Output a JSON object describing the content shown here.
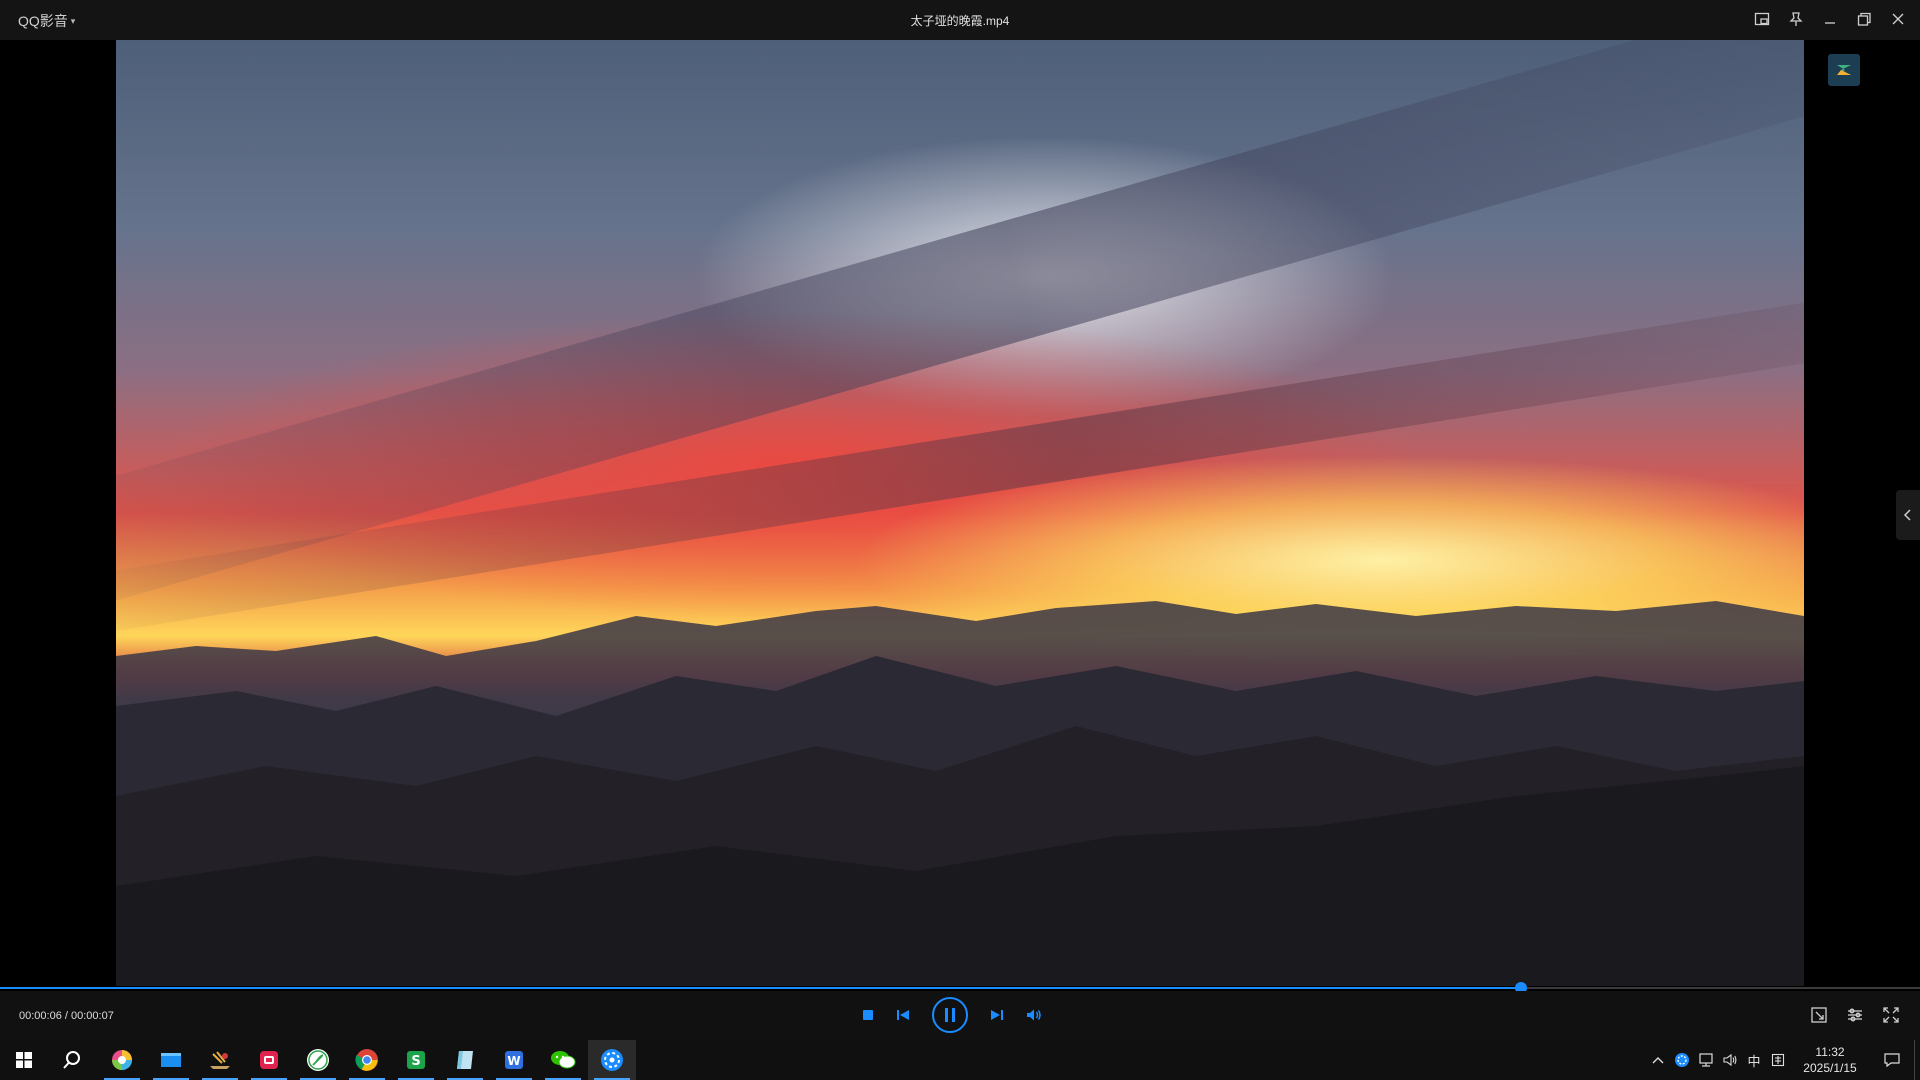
{
  "app": {
    "brand": "QQ影音",
    "title": "太子垭的晚霞.mp4"
  },
  "window_controls": [
    "miniplayer-icon",
    "pin-icon",
    "minimize-icon",
    "restore-icon",
    "close-icon"
  ],
  "player": {
    "current_time": "00:00:06",
    "total_time": "00:00:07",
    "time_display": "00:00:06 / 00:00:07",
    "progress_fraction": 0.792,
    "state": "playing"
  },
  "colors": {
    "accent": "#1a8cff",
    "titlebar": "#141414",
    "controlbar": "#111111",
    "taskbar": "#101010"
  },
  "taskbar": {
    "apps": [
      {
        "name": "start-icon"
      },
      {
        "name": "search-icon"
      },
      {
        "name": "color-ball-app-icon"
      },
      {
        "name": "mail-app-icon"
      },
      {
        "name": "music-app-icon"
      },
      {
        "name": "red-app-icon"
      },
      {
        "name": "feather-app-icon"
      },
      {
        "name": "chrome-icon"
      },
      {
        "name": "wps-sheet-icon"
      },
      {
        "name": "notes-app-icon"
      },
      {
        "name": "wps-writer-icon"
      },
      {
        "name": "wechat-icon"
      },
      {
        "name": "qq-player-icon"
      }
    ],
    "tray": {
      "ime": "中",
      "clock_time": "11:32",
      "clock_date": "2025/1/15"
    }
  }
}
